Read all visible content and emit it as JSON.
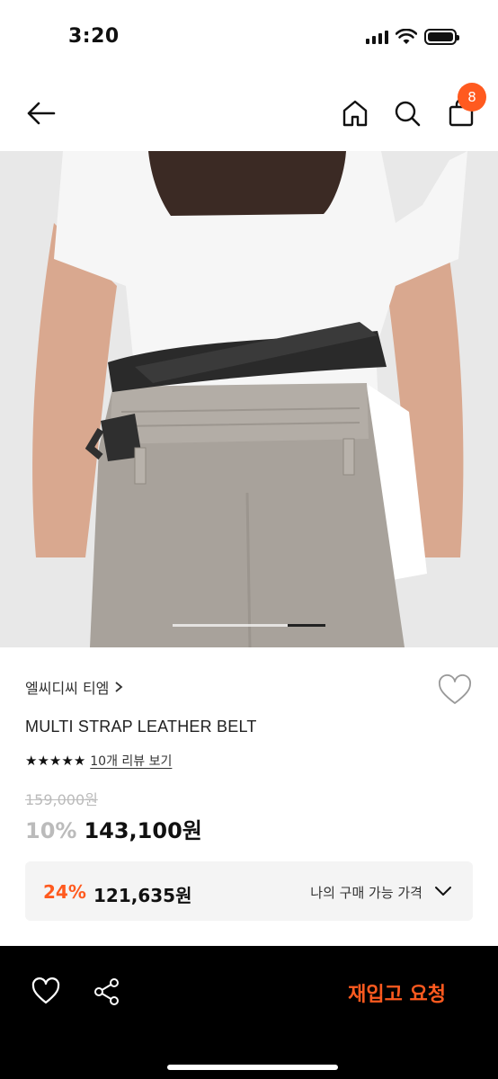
{
  "status_bar": {
    "time": "3:20"
  },
  "nav": {
    "cart_count": "8"
  },
  "product": {
    "brand": "엘씨디씨 티엠",
    "name": "MULTI STRAP LEATHER BELT",
    "rating_stars": 5,
    "review_link": "10개 리뷰 보기",
    "original_price": "159,000원",
    "discount_rate": "10%",
    "sale_price": "143,100원",
    "image_index": 4,
    "image_count": 5
  },
  "coupon": {
    "rate": "24%",
    "price": "121,635원",
    "label": "나의 구매 가능 가격"
  },
  "bottom_bar": {
    "restock_label": "재입고 요청"
  },
  "colors": {
    "accent": "#ff5a1f",
    "text": "#111111",
    "muted": "#bbbbbb",
    "bottom_bar": "#000000"
  }
}
